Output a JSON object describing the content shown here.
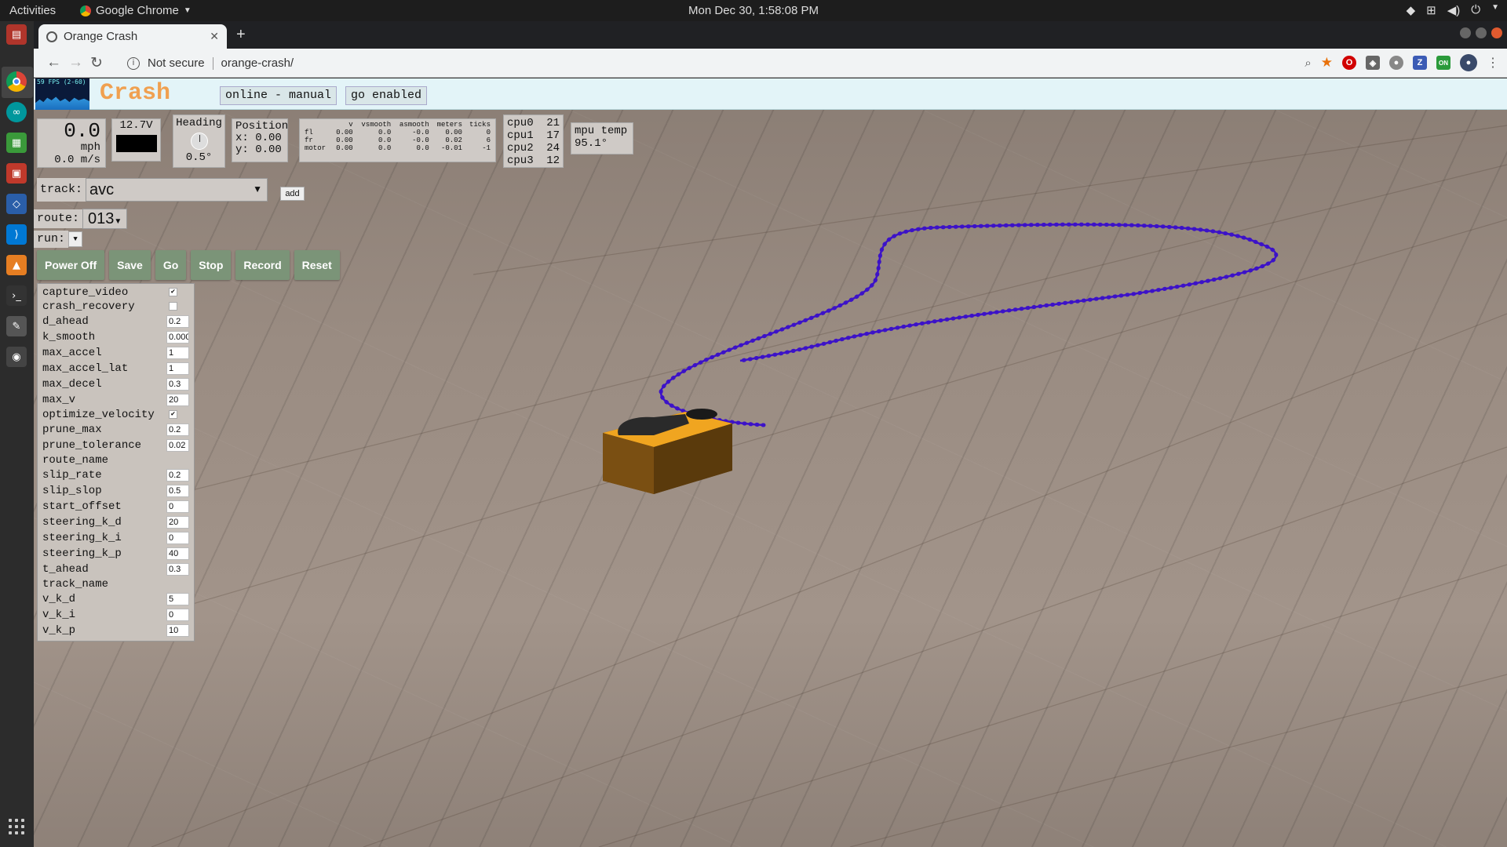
{
  "os": {
    "activities": "Activities",
    "app_name": "Google Chrome",
    "clock": "Mon Dec 30,  1:58:08 PM"
  },
  "browser": {
    "tab_title": "Orange Crash",
    "security": "Not secure",
    "url": "orange-crash/"
  },
  "app": {
    "fps_label": "59 FPS (2-60)",
    "title": "ge Crash",
    "status_mode": "online - manual",
    "status_go": "go enabled"
  },
  "telemetry": {
    "speed_mph": "0.0",
    "speed_mph_unit": "mph",
    "speed_ms": "0.0 m/s",
    "voltage": "12.7V",
    "heading_label": "Heading",
    "heading_value": "0.5°",
    "position_label": "Position",
    "position_x": "x: 0.00",
    "position_y": "y: 0.00",
    "wheel_headers": [
      "",
      "v",
      "vsmooth",
      "asmooth",
      "meters",
      "ticks"
    ],
    "wheel_rows": [
      [
        "fl",
        "0.00",
        "0.0",
        "-0.0",
        "0.00",
        "0"
      ],
      [
        "fr",
        "0.00",
        "0.0",
        "-0.0",
        "0.02",
        "6"
      ],
      [
        "motor",
        "0.00",
        "0.0",
        "0.0",
        "-0.01",
        "-1"
      ]
    ],
    "cpus": [
      {
        "name": "cpu0",
        "value": "21"
      },
      {
        "name": "cpu1",
        "value": "17"
      },
      {
        "name": "cpu2",
        "value": "24"
      },
      {
        "name": "cpu3",
        "value": "12"
      }
    ],
    "mpu_label": "mpu temp",
    "mpu_value": "95.1°"
  },
  "controls": {
    "track_label": "track:",
    "track_value": "avc",
    "add_label": "add",
    "route_label": "route:",
    "route_value": "013",
    "run_label": "run:",
    "buttons": [
      "Power Off",
      "Save",
      "Go",
      "Stop",
      "Record",
      "Reset"
    ]
  },
  "params": [
    {
      "name": "capture_video",
      "type": "checkbox",
      "checked": true
    },
    {
      "name": "crash_recovery",
      "type": "checkbox",
      "checked": false
    },
    {
      "name": "d_ahead",
      "type": "input",
      "value": "0.2"
    },
    {
      "name": "k_smooth",
      "type": "input",
      "value": "0.000"
    },
    {
      "name": "max_accel",
      "type": "input",
      "value": "1"
    },
    {
      "name": "max_accel_lat",
      "type": "input",
      "value": "1"
    },
    {
      "name": "max_decel",
      "type": "input",
      "value": "0.3"
    },
    {
      "name": "max_v",
      "type": "input",
      "value": "20"
    },
    {
      "name": "optimize_velocity",
      "type": "checkbox",
      "checked": true
    },
    {
      "name": "prune_max",
      "type": "input",
      "value": "0.2"
    },
    {
      "name": "prune_tolerance",
      "type": "input",
      "value": "0.02"
    },
    {
      "name": "route_name",
      "type": "text"
    },
    {
      "name": "slip_rate",
      "type": "input",
      "value": "0.2"
    },
    {
      "name": "slip_slop",
      "type": "input",
      "value": "0.5"
    },
    {
      "name": "start_offset",
      "type": "input",
      "value": "0"
    },
    {
      "name": "steering_k_d",
      "type": "input",
      "value": "20"
    },
    {
      "name": "steering_k_i",
      "type": "input",
      "value": "0"
    },
    {
      "name": "steering_k_p",
      "type": "input",
      "value": "40"
    },
    {
      "name": "t_ahead",
      "type": "input",
      "value": "0.3"
    },
    {
      "name": "track_name",
      "type": "text"
    },
    {
      "name": "v_k_d",
      "type": "input",
      "value": "5"
    },
    {
      "name": "v_k_i",
      "type": "input",
      "value": "0"
    },
    {
      "name": "v_k_p",
      "type": "input",
      "value": "10"
    }
  ],
  "colors": {
    "path": "#3c12c8",
    "car_body": "#f0a520",
    "floor": "#9a8c82",
    "button": "#7b9478"
  }
}
